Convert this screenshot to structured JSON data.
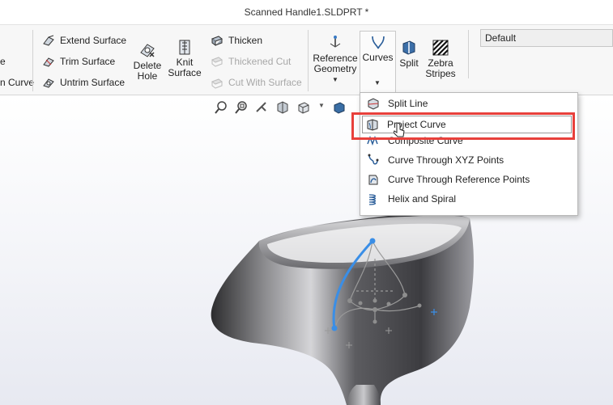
{
  "window": {
    "title": "Scanned Handle1.SLDPRT *"
  },
  "ribbon": {
    "left_partial_1": "e",
    "left_partial_2": "n Curve",
    "extend_surface": "Extend Surface",
    "trim_surface": "Trim Surface",
    "untrim_surface": "Untrim Surface",
    "delete_hole_1": "Delete",
    "delete_hole_2": "Hole",
    "knit_surface_1": "Knit",
    "knit_surface_2": "Surface",
    "thicken": "Thicken",
    "thickened_cut": "Thickened Cut",
    "cut_with_surface": "Cut With Surface",
    "reference_geometry_1": "Reference",
    "reference_geometry_2": "Geometry",
    "curves": "Curves",
    "split": "Split",
    "zebra_stripes_1": "Zebra",
    "zebra_stripes_2": "Stripes",
    "config_select": "Default"
  },
  "curves_menu": {
    "items": [
      {
        "label": "Split Line",
        "icon": "split-line-icon"
      },
      {
        "label": "Project Curve",
        "icon": "project-curve-icon"
      },
      {
        "label": "Composite Curve",
        "icon": "composite-curve-icon"
      },
      {
        "label": "Curve Through XYZ Points",
        "icon": "curve-xyz-icon"
      },
      {
        "label": "Curve Through Reference Points",
        "icon": "curve-ref-points-icon"
      },
      {
        "label": "Helix and Spiral",
        "icon": "helix-icon"
      }
    ],
    "highlighted": "Project Curve"
  },
  "colors": {
    "highlight_border": "#e8403b",
    "curve_blue": "#3a8ee6",
    "model_dark": "#3b3b3d"
  }
}
